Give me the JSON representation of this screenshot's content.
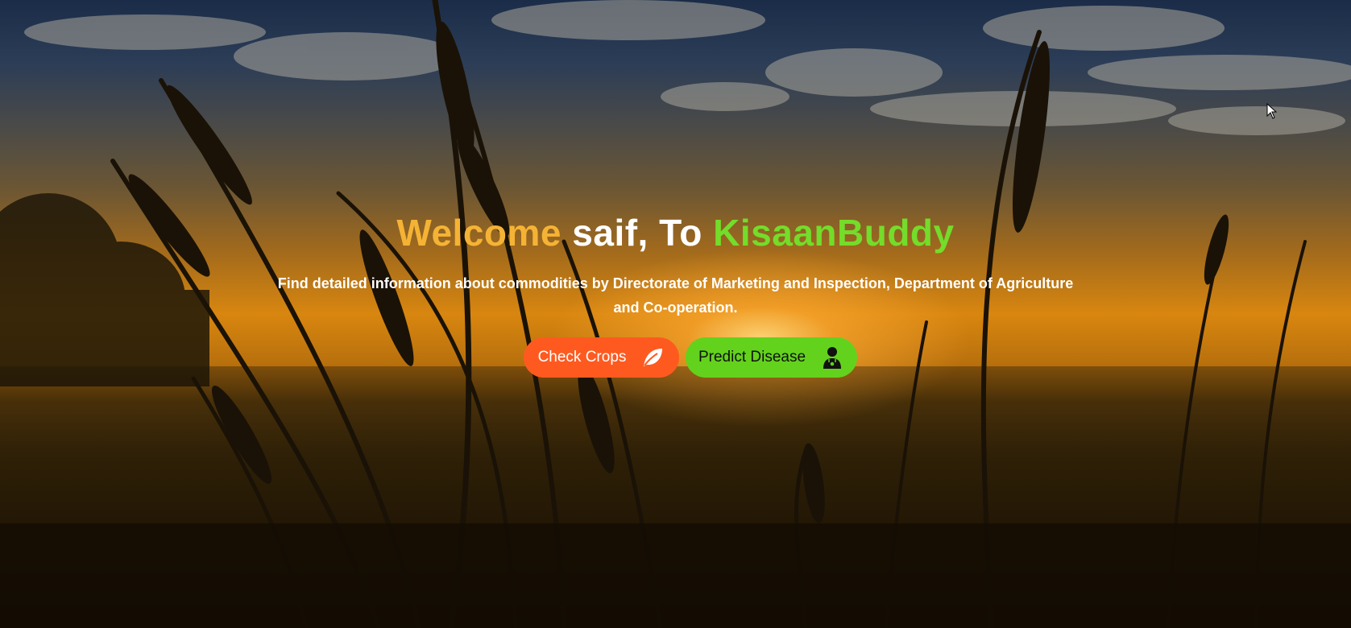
{
  "hero": {
    "title_welcome": "Welcome",
    "title_name": " saif, To ",
    "title_brand": "KisaanBuddy",
    "subtitle": "Find detailed information about commodities by Directorate of Marketing and Inspection, Department of Agriculture and Co-operation."
  },
  "buttons": {
    "check_crops": {
      "label": "Check Crops",
      "icon": "leaf-icon"
    },
    "predict_disease": {
      "label": "Predict Disease",
      "icon": "doctor-icon"
    }
  },
  "colors": {
    "welcome": "#f5b335",
    "brand": "#74dc2a",
    "check_crops_bg": "#fe5a20",
    "predict_disease_bg": "#63d21c"
  }
}
